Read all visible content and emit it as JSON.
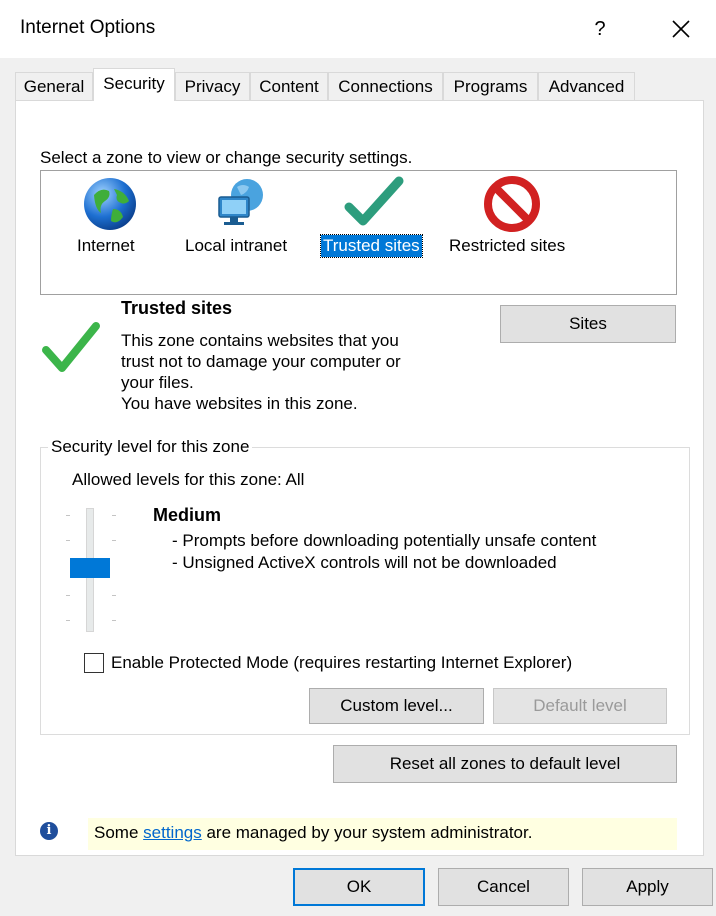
{
  "window": {
    "title": "Internet Options",
    "help_label": "?",
    "close_icon": "close-icon"
  },
  "tabs": [
    {
      "label": "General",
      "active": false
    },
    {
      "label": "Security",
      "active": true
    },
    {
      "label": "Privacy",
      "active": false
    },
    {
      "label": "Content",
      "active": false
    },
    {
      "label": "Connections",
      "active": false
    },
    {
      "label": "Programs",
      "active": false
    },
    {
      "label": "Advanced",
      "active": false
    }
  ],
  "security": {
    "zone_prompt": "Select a zone to view or change security settings.",
    "zones": [
      {
        "label": "Internet",
        "icon": "globe-icon",
        "selected": false
      },
      {
        "label": "Local intranet",
        "icon": "intranet-icon",
        "selected": false
      },
      {
        "label": "Trusted sites",
        "icon": "checkmark-icon",
        "selected": true
      },
      {
        "label": "Restricted sites",
        "icon": "restricted-icon",
        "selected": false
      }
    ],
    "selected_zone": {
      "title": "Trusted sites",
      "description_lines": [
        "This zone contains websites that you",
        "trust not to damage your computer or",
        "your files.",
        "You have websites in this zone."
      ]
    },
    "sites_button": "Sites",
    "level_group": {
      "legend": "Security level for this zone",
      "allowed": "Allowed levels for this zone: All",
      "level_name": "Medium",
      "level_details": [
        "- Prompts before downloading potentially unsafe content",
        "- Unsigned ActiveX controls will not be downloaded"
      ],
      "slider_level": "Medium",
      "protected_mode_label": "Enable Protected Mode (requires restarting Internet Explorer)",
      "protected_mode_checked": false,
      "custom_level_button": "Custom level...",
      "default_level_button": "Default level",
      "default_level_enabled": false
    },
    "reset_all_button": "Reset all zones to default level",
    "info": {
      "icon": "info-icon",
      "prefix": "Some ",
      "link": "settings",
      "suffix": " are managed by your system administrator."
    }
  },
  "footer": {
    "ok": "OK",
    "cancel": "Cancel",
    "apply": "Apply"
  },
  "colors": {
    "accent": "#0078d7",
    "info_background": "#ffffe1",
    "link": "#0066cc"
  }
}
